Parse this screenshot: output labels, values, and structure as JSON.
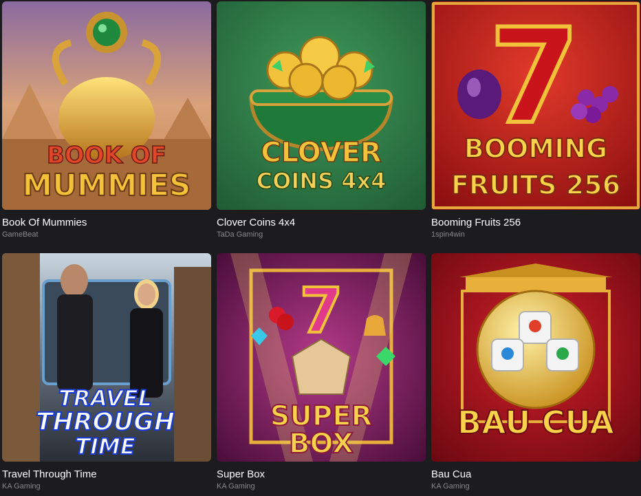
{
  "games": [
    {
      "title": "Book Of Mummies",
      "provider": "GameBeat",
      "art_line1": "BOOK OF",
      "art_line2": "MUMMIES"
    },
    {
      "title": "Clover Coins 4x4",
      "provider": "TaDa Gaming",
      "art_line1": "CLOVER",
      "art_line2": "COINS 4x4"
    },
    {
      "title": "Booming Fruits 256",
      "provider": "1spin4win",
      "art_line1": "BOOMING",
      "art_line2": "FRUITS 256"
    },
    {
      "title": "Travel Through Time",
      "provider": "KA Gaming",
      "art_line1": "TRAVEL",
      "art_line2": "THROUGH",
      "art_line3": "TIME"
    },
    {
      "title": "Super Box",
      "provider": "KA Gaming",
      "art_line1": "SUPER",
      "art_line2": "BOX"
    },
    {
      "title": "Bau Cua",
      "provider": "KA Gaming",
      "art_line1": "BAU CUA"
    }
  ],
  "colors": {
    "page_bg": "#1c1c1e",
    "title_text": "#ffffff",
    "provider_text": "#8a8a8e"
  }
}
